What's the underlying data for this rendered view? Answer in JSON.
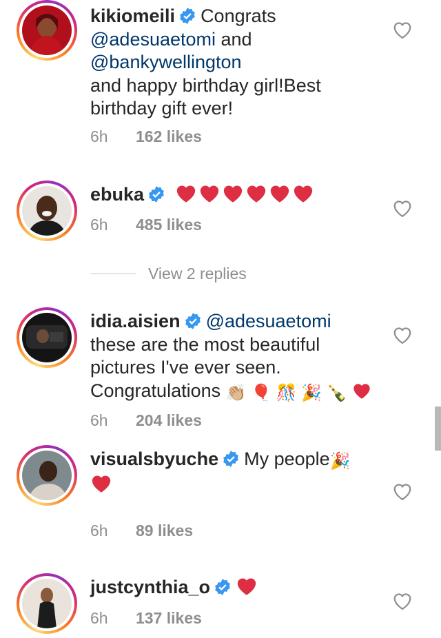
{
  "comments": [
    {
      "username": "kikiomeili",
      "text_before": "Congrats",
      "mention1": "@adesuaetomi",
      "and": " and",
      "mention2": "@bankywellington",
      "text_after": "and happy birthday girl!Best birthday gift ever!",
      "time": "6h",
      "likes": "162 likes"
    },
    {
      "username": "ebuka",
      "time": "6h",
      "likes": "485 likes",
      "view_replies": "View 2 replies"
    },
    {
      "username": "idia.aisien",
      "mention": "@adesuaetomi",
      "text": "these are the most beautiful pictures I've ever seen. Congratulations",
      "emoji_tail": "👏🏼 🎈 🎊 🎉 🍾",
      "time": "6h",
      "likes": "204 likes"
    },
    {
      "username": "visualsbyuche",
      "text": "My people",
      "emoji_tail": "🎉",
      "time": "6h",
      "likes": "89 likes"
    },
    {
      "username": "justcynthia_o",
      "time": "6h",
      "likes": "137 likes"
    }
  ],
  "colors": {
    "verified": "#3897f0",
    "heart": "#ed4956",
    "mention": "#00376b",
    "meta": "#8e8e8e"
  },
  "icons": [
    "verified-badge-icon",
    "heart-outline-icon",
    "red-heart-emoji"
  ]
}
